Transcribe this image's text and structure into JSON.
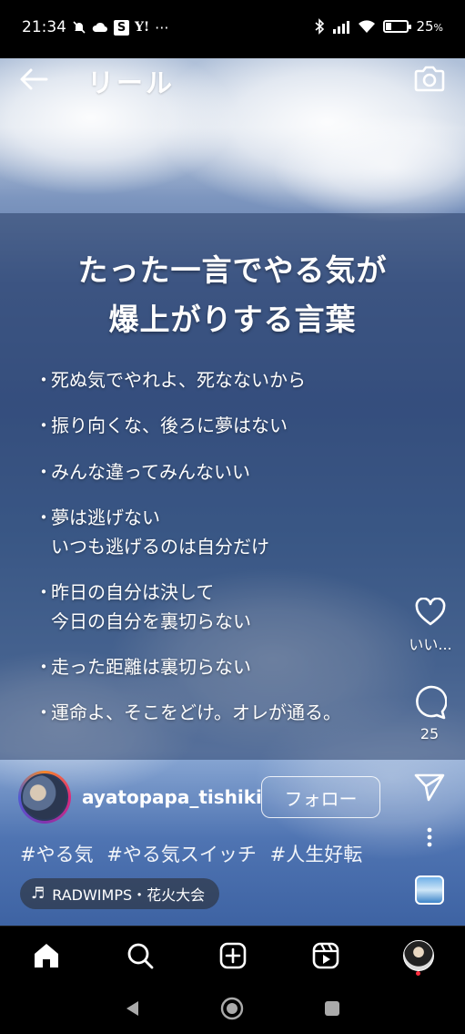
{
  "status_bar": {
    "time": "21:34",
    "s_badge": "S",
    "yahoo": "Y!",
    "more": "···",
    "battery_text": "25",
    "battery_unit": "%",
    "battery_level": 0.25
  },
  "header": {
    "title": "リール"
  },
  "reel": {
    "headline_line1": "たった一言でやる気が",
    "headline_line2": "爆上がりする言葉",
    "bullet": "・",
    "quotes": [
      {
        "line1": "死ぬ気でやれよ、死なないから",
        "line2": ""
      },
      {
        "line1": "振り向くな、後ろに夢はない",
        "line2": ""
      },
      {
        "line1": "みんな違ってみんないい",
        "line2": ""
      },
      {
        "line1": "夢は逃げない",
        "line2": "いつも逃げるのは自分だけ"
      },
      {
        "line1": "昨日の自分は決して",
        "line2": "今日の自分を裏切らない"
      },
      {
        "line1": "走った距離は裏切らない",
        "line2": ""
      },
      {
        "line1": "運命よ、そこをどけ。オレが通る。",
        "line2": ""
      }
    ]
  },
  "actions": {
    "like_label": "いい...",
    "comment_count": "25"
  },
  "post": {
    "username": "ayatopapa_tishiki",
    "follow_label": "フォロー",
    "hashtags": [
      "#やる気",
      "#やる気スイッチ",
      "#人生好転"
    ],
    "music_note": "♬",
    "music": "RADWIMPS・花火大会"
  },
  "colors": {
    "accent_story_ring": "#dd2a7b",
    "notification_dot": "#ff3040"
  }
}
